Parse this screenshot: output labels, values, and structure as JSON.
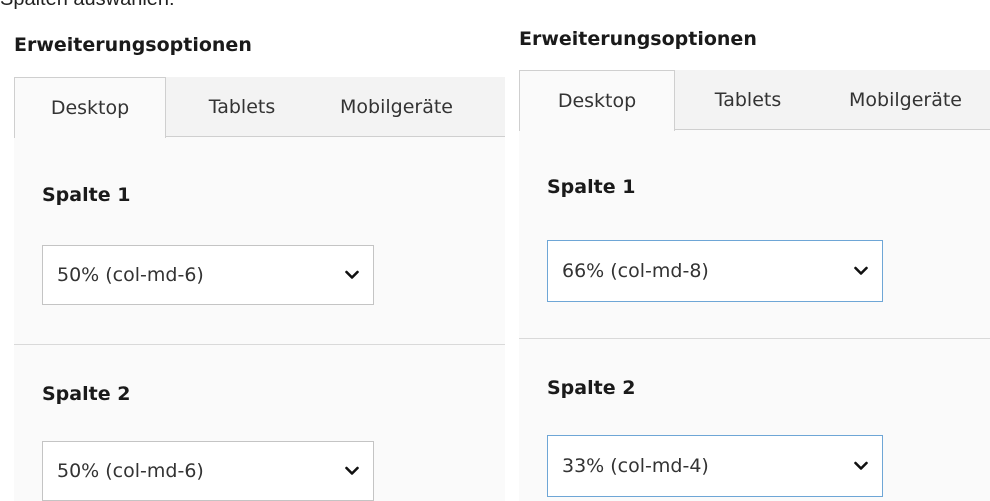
{
  "caption": "Spalten auswählen:",
  "panels": [
    {
      "title": "Erweiterungsoptionen",
      "tabs": [
        {
          "label": "Desktop",
          "active": true
        },
        {
          "label": "Tablets",
          "active": false
        },
        {
          "label": "Mobilgeräte",
          "active": false
        }
      ],
      "columns": [
        {
          "label": "Spalte 1",
          "value": "50% (col-md-6)"
        },
        {
          "label": "Spalte 2",
          "value": "50% (col-md-6)"
        }
      ]
    },
    {
      "title": "Erweiterungsoptionen",
      "tabs": [
        {
          "label": "Desktop",
          "active": true
        },
        {
          "label": "Tablets",
          "active": false
        },
        {
          "label": "Mobilgeräte",
          "active": false
        }
      ],
      "columns": [
        {
          "label": "Spalte 1",
          "value": "66% (col-md-8)"
        },
        {
          "label": "Spalte 2",
          "value": "33% (col-md-4)"
        }
      ]
    }
  ],
  "colors": {
    "select_border_focus": "#6ea6d6",
    "tab_bar_bg": "#f3f3f3"
  }
}
